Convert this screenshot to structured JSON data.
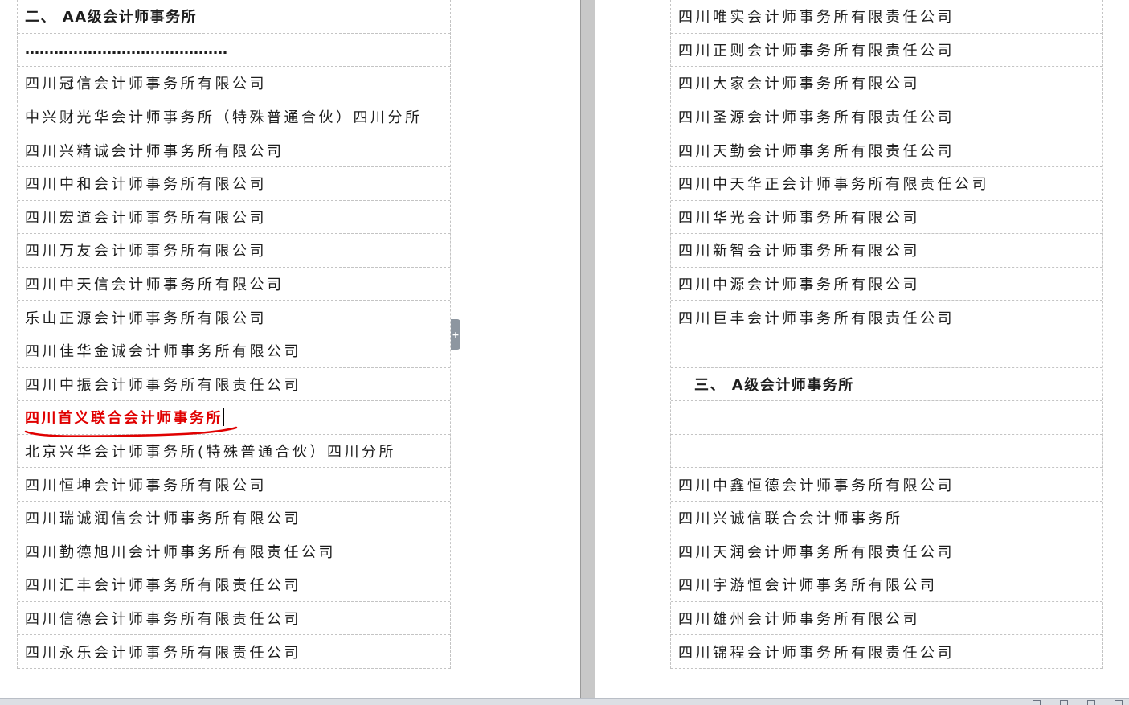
{
  "left_column": {
    "rows": [
      {
        "text": "二、  AA级会计师事务所",
        "kind": "heading"
      },
      {
        "text": "……………………………………",
        "kind": "dots"
      },
      {
        "text": "四川冠信会计师事务所有限公司"
      },
      {
        "text": "中兴财光华会计师事务所（特殊普通合伙）四川分所"
      },
      {
        "text": "四川兴精诚会计师事务所有限公司"
      },
      {
        "text": "四川中和会计师事务所有限公司"
      },
      {
        "text": "四川宏道会计师事务所有限公司"
      },
      {
        "text": "四川万友会计师事务所有限公司"
      },
      {
        "text": "四川中天信会计师事务所有限公司"
      },
      {
        "text": "乐山正源会计师事务所有限公司"
      },
      {
        "text": "四川佳华金诚会计师事务所有限公司"
      },
      {
        "text": "四川中振会计师事务所有限责任公司"
      },
      {
        "text": "四川首义联合会计师事务所",
        "kind": "highlight"
      },
      {
        "text": "北京兴华会计师事务所(特殊普通合伙）四川分所"
      },
      {
        "text": "四川恒坤会计师事务所有限公司"
      },
      {
        "text": "四川瑞诚润信会计师事务所有限公司"
      },
      {
        "text": "四川勤德旭川会计师事务所有限责任公司"
      },
      {
        "text": "四川汇丰会计师事务所有限责任公司"
      },
      {
        "text": "四川信德会计师事务所有限责任公司"
      },
      {
        "text": "四川永乐会计师事务所有限责任公司"
      }
    ]
  },
  "right_column": {
    "rows": [
      {
        "text": "四川唯实会计师事务所有限责任公司"
      },
      {
        "text": "四川正则会计师事务所有限责任公司"
      },
      {
        "text": "四川大家会计师事务所有限公司"
      },
      {
        "text": "四川圣源会计师事务所有限责任公司"
      },
      {
        "text": "四川天勤会计师事务所有限责任公司"
      },
      {
        "text": "四川中天华正会计师事务所有限责任公司"
      },
      {
        "text": "四川华光会计师事务所有限公司"
      },
      {
        "text": "四川新智会计师事务所有限公司"
      },
      {
        "text": "四川中源会计师事务所有限公司"
      },
      {
        "text": "四川巨丰会计师事务所有限责任公司"
      },
      {
        "text": ""
      },
      {
        "text": "三、  A级会计师事务所",
        "kind": "heading"
      },
      {
        "text": ""
      },
      {
        "text": ""
      },
      {
        "text": "四川中鑫恒德会计师事务所有限公司"
      },
      {
        "text": "四川兴诚信联合会计师事务所"
      },
      {
        "text": "四川天润会计师事务所有限责任公司"
      },
      {
        "text": "四川宇游恒会计师事务所有限公司"
      },
      {
        "text": "四川雄州会计师事务所有限公司"
      },
      {
        "text": "四川锦程会计师事务所有限责任公司"
      }
    ]
  },
  "colors": {
    "highlight_text": "#e00000",
    "annotation_stroke": "#e00000",
    "gridline": "#c4c4c4"
  },
  "icons": {
    "resize_tab": "plus-icon",
    "annotation": "hand-drawn-underline"
  }
}
